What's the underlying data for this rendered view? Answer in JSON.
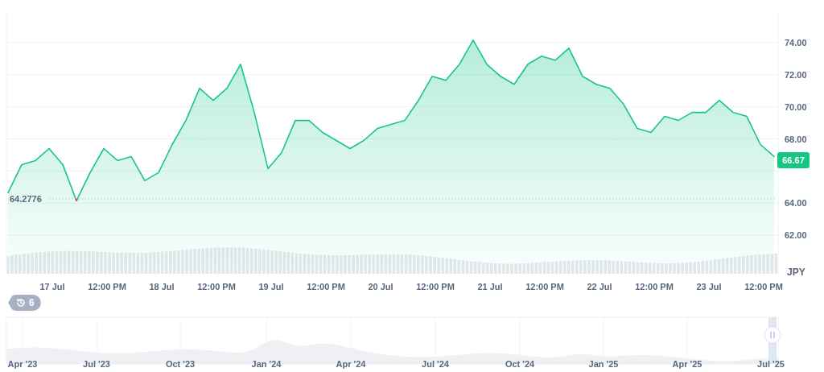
{
  "price_chart": {
    "currency": "JPY",
    "current_price": "66.67",
    "chart_data": {
      "type": "area",
      "grid": true,
      "ylim": [
        59.6,
        75.9
      ],
      "categories": [
        null,
        null,
        null,
        "17 Jul",
        null,
        null,
        null,
        "12:00 PM",
        null,
        null,
        null,
        "18 Jul",
        null,
        null,
        null,
        "12:00 PM",
        null,
        null,
        null,
        "19 Jul",
        null,
        null,
        null,
        "12:00 PM",
        null,
        null,
        null,
        "20 Jul",
        null,
        null,
        null,
        "12:00 PM",
        null,
        null,
        null,
        "21 Jul",
        null,
        null,
        null,
        "12:00 PM",
        null,
        null,
        null,
        "22 Jul",
        null,
        null,
        null,
        "12:00 PM",
        null,
        null,
        null,
        "23 Jul",
        null,
        null,
        null,
        "12:00 PM",
        null
      ],
      "ref_lines": [
        {
          "axis": "y",
          "value": 64.2776,
          "label": "64.2776"
        }
      ],
      "yticks": [
        {
          "value": 62,
          "label": "62.00"
        },
        {
          "value": 64,
          "label": "64.00"
        },
        {
          "value": 68,
          "label": "68.00"
        },
        {
          "value": 70,
          "label": "70.00"
        },
        {
          "value": 72,
          "label": "72.00"
        },
        {
          "value": 74,
          "label": "74.00"
        }
      ],
      "series": [
        {
          "color": "#16c784",
          "values": [
            64.65,
            66.4,
            66.65,
            67.4,
            66.4,
            64.15,
            65.9,
            67.4,
            66.65,
            66.9,
            65.4,
            65.9,
            67.65,
            69.15,
            71.15,
            70.4,
            71.15,
            72.65,
            69.65,
            66.15,
            67.15,
            69.15,
            69.15,
            68.4,
            67.9,
            67.4,
            67.9,
            68.65,
            68.9,
            69.15,
            70.4,
            71.9,
            71.65,
            72.65,
            74.15,
            72.65,
            71.9,
            71.4,
            72.65,
            73.15,
            72.9,
            73.65,
            71.9,
            71.4,
            71.15,
            70.15,
            68.65,
            68.4,
            69.4,
            69.15,
            69.65,
            69.65,
            70.4,
            69.65,
            69.4,
            67.65,
            66.9
          ]
        }
      ]
    }
  },
  "navigator": {
    "history_count": "6",
    "labels": [
      "Apr '23",
      "Jul '23",
      "Oct '23",
      "Jan '24",
      "Apr '24",
      "Jul '24",
      "Oct '24",
      "Jan '25",
      "Apr '25",
      "Jul '25"
    ]
  }
}
